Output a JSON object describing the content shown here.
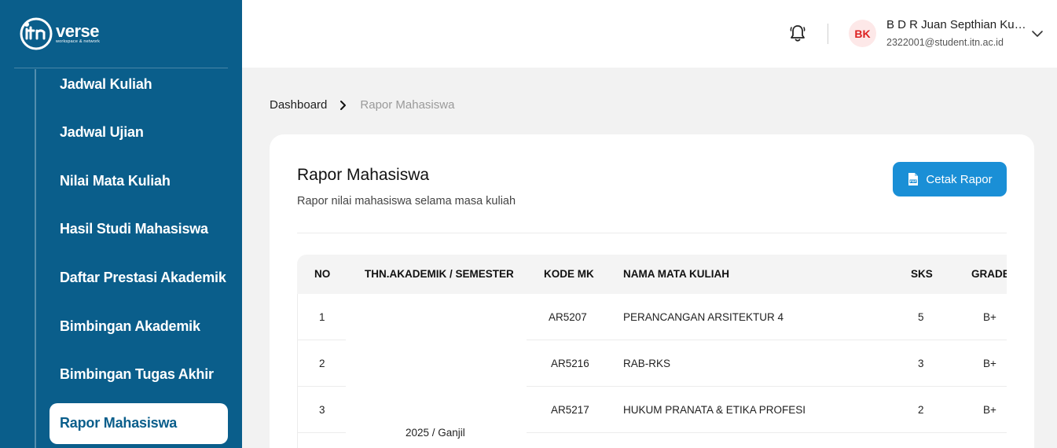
{
  "brand": {
    "name": "verse",
    "mark": "itn",
    "tagline": "workspace & network"
  },
  "sidebar": {
    "items": [
      {
        "label": "Jadwal Kuliah"
      },
      {
        "label": "Jadwal Ujian"
      },
      {
        "label": "Nilai Mata Kuliah"
      },
      {
        "label": "Hasil Studi Mahasiswa"
      },
      {
        "label": "Daftar Prestasi Akademik"
      },
      {
        "label": "Bimbingan Akademik"
      },
      {
        "label": "Bimbingan Tugas Akhir"
      },
      {
        "label": "Rapor Mahasiswa",
        "active": true
      }
    ]
  },
  "header": {
    "notification_icon": "bell-icon",
    "user": {
      "initials": "BK",
      "name": "B D R Juan Septhian Kur...",
      "email": "2322001@student.itn.ac.id"
    }
  },
  "breadcrumb": {
    "home": "Dashboard",
    "current": "Rapor Mahasiswa"
  },
  "page": {
    "title": "Rapor Mahasiswa",
    "subtitle": "Rapor nilai mahasiswa selama masa kuliah",
    "print_button": "Cetak Rapor"
  },
  "table": {
    "headers": [
      "NO",
      "THN.AKADEMIK / SEMESTER",
      "KODE MK",
      "NAMA MATA KULIAH",
      "SKS",
      "GRADE"
    ],
    "semester_group": "2025 / Ganjil",
    "rows": [
      {
        "no": "1",
        "kode": "AR5207",
        "nama": "PERANCANGAN ARSITEKTUR 4",
        "sks": "5",
        "grade": "B+"
      },
      {
        "no": "2",
        "kode": "AR5216",
        "nama": "RAB-RKS",
        "sks": "3",
        "grade": "B+"
      },
      {
        "no": "3",
        "kode": "AR5217",
        "nama": "HUKUM PRANATA & ETIKA PROFESI",
        "sks": "2",
        "grade": "B+"
      }
    ]
  },
  "colors": {
    "sidebar": "#0a5e8b",
    "accent": "#1a8fd6",
    "avatar_bg": "#fde8e8",
    "avatar_text": "#dd2222"
  }
}
